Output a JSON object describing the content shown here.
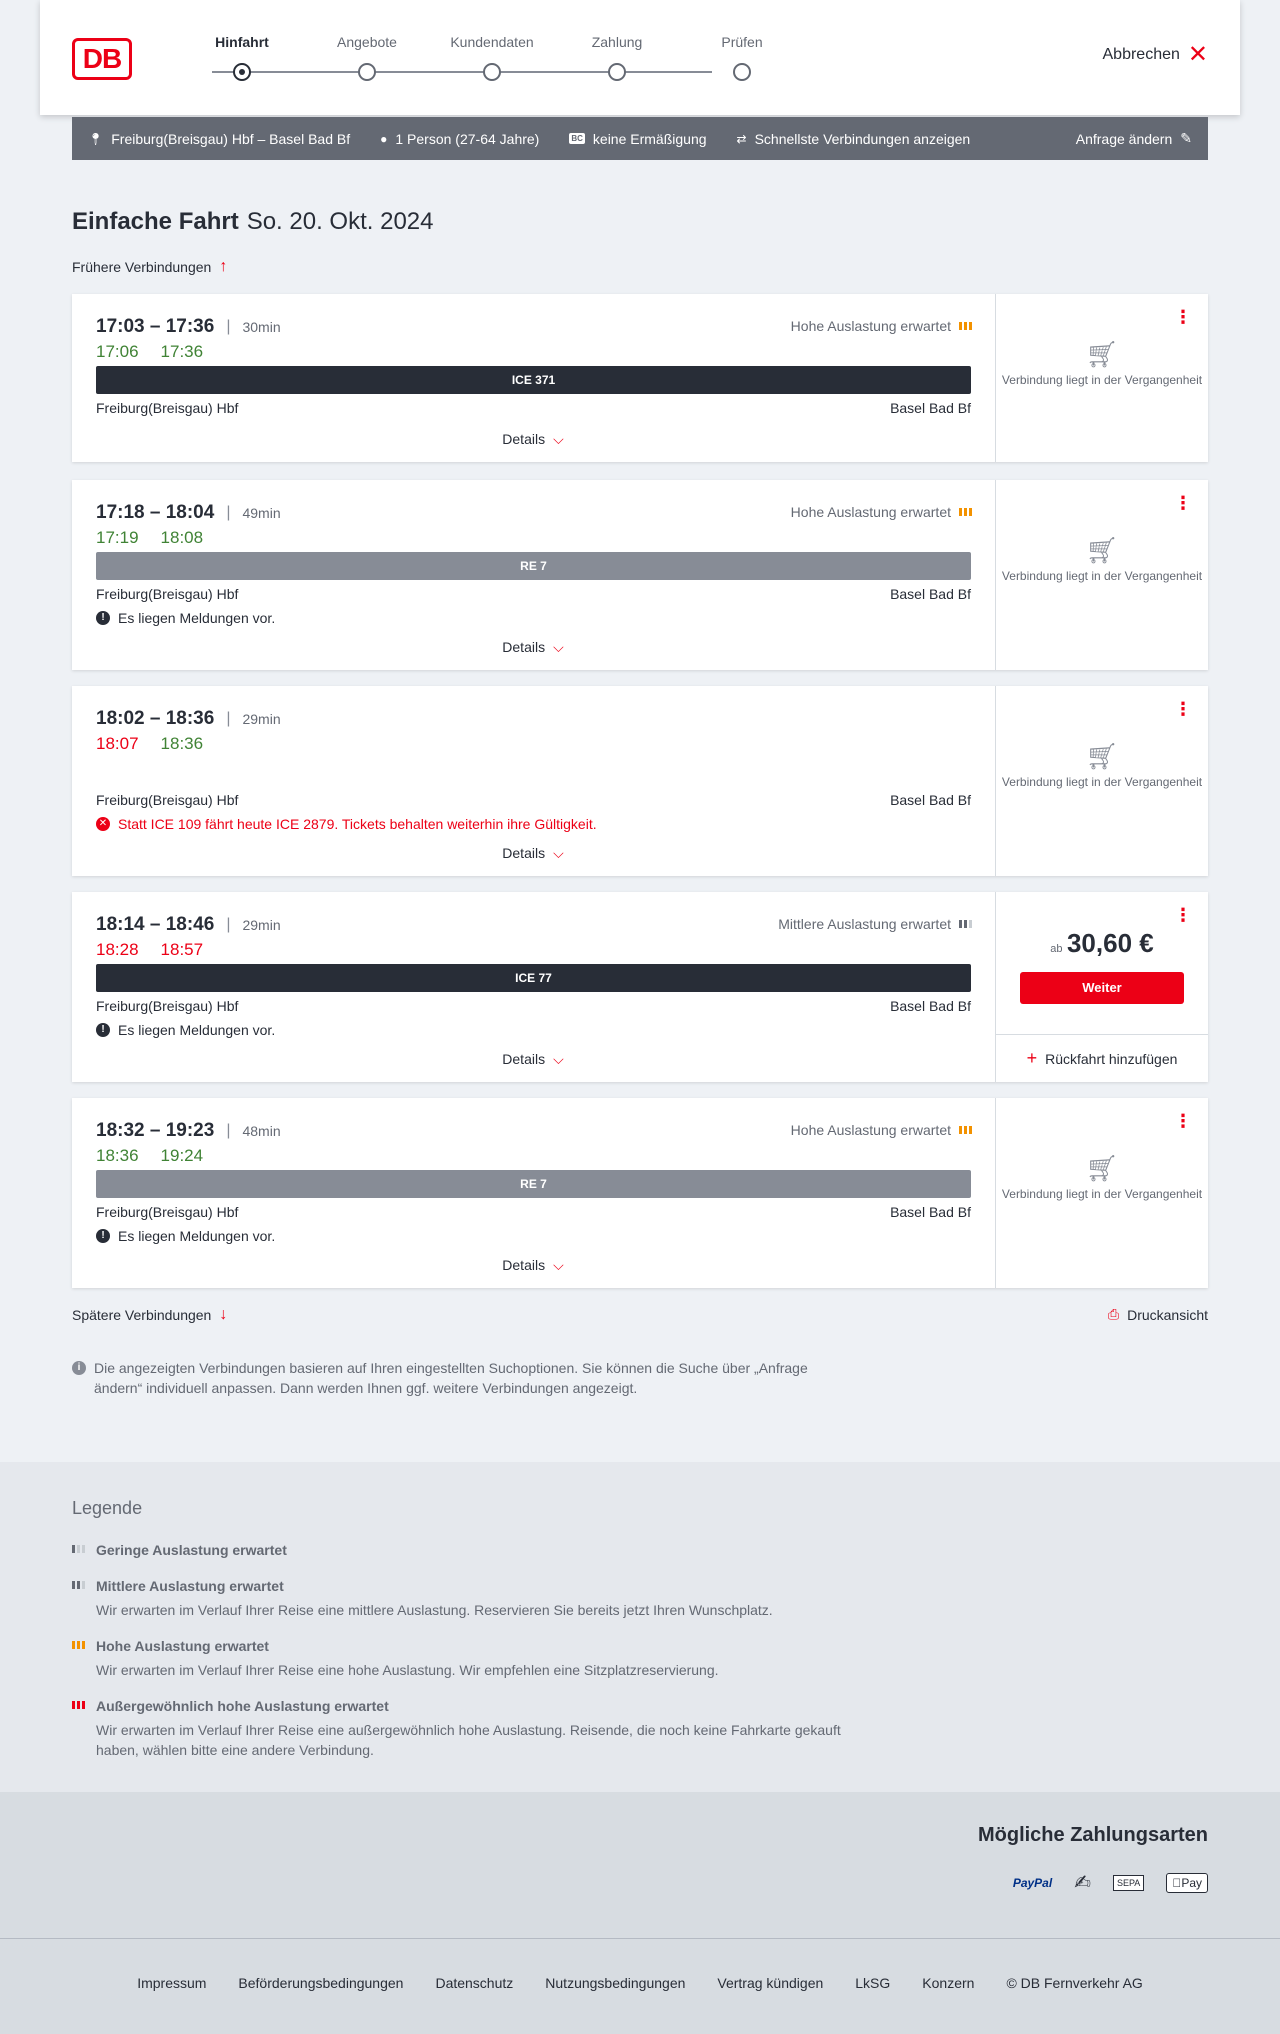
{
  "header": {
    "logo": "DB",
    "steps": [
      "Hinfahrt",
      "Angebote",
      "Kundendaten",
      "Zahlung",
      "Prüfen"
    ],
    "cancel": "Abbrechen"
  },
  "search": {
    "route": "Freiburg(Breisgau) Hbf – Basel Bad Bf",
    "passengers": "1 Person (27-64 Jahre)",
    "bc_badge": "BC",
    "discount": "keine Ermäßigung",
    "option": "Schnellste Verbindungen anzeigen",
    "change": "Anfrage ändern"
  },
  "title": {
    "type": "Einfache Fahrt",
    "date": "So. 20. Okt. 2024"
  },
  "earlier": "Frühere Verbindungen",
  "later": "Spätere Verbindungen",
  "print": "Druckansicht",
  "details_label": "Details",
  "past_text": "Verbindung liegt in der Vergangenheit",
  "connections": [
    {
      "time": "17:03 – 17:36",
      "dur": "30min",
      "rt_dep": "17:06",
      "rt_arr": "17:36",
      "load": "Hohe Auslastung erwartet",
      "train": "ICE 371",
      "from": "Freiburg(Breisgau) Hbf",
      "to": "Basel Bad Bf"
    },
    {
      "time": "17:18 – 18:04",
      "dur": "49min",
      "rt_dep": "17:19",
      "rt_arr": "18:08",
      "load": "Hohe Auslastung erwartet",
      "train": "RE 7",
      "from": "Freiburg(Breisgau) Hbf",
      "to": "Basel Bad Bf",
      "msg": "Es liegen Meldungen vor."
    },
    {
      "time": "18:02 – 18:36",
      "dur": "29min",
      "rt_dep": "18:07",
      "rt_arr": "18:36",
      "from": "Freiburg(Breisgau) Hbf",
      "to": "Basel Bad Bf",
      "msg": "Statt ICE 109 fährt heute ICE 2879. Tickets behalten weiterhin ihre Gültigkeit."
    },
    {
      "time": "18:14 – 18:46",
      "dur": "29min",
      "rt_dep": "18:28",
      "rt_arr": "18:57",
      "load": "Mittlere Auslastung erwartet",
      "train": "ICE 77",
      "from": "Freiburg(Breisgau) Hbf",
      "to": "Basel Bad Bf",
      "msg": "Es liegen Meldungen vor.",
      "price_prefix": "ab",
      "price": "30,60 €",
      "button": "Weiter",
      "add_return": "Rückfahrt hinzufügen"
    },
    {
      "time": "18:32 – 19:23",
      "dur": "48min",
      "rt_dep": "18:36",
      "rt_arr": "19:24",
      "load": "Hohe Auslastung erwartet",
      "train": "RE 7",
      "from": "Freiburg(Breisgau) Hbf",
      "to": "Basel Bad Bf",
      "msg": "Es liegen Meldungen vor."
    }
  ],
  "note": "Die angezeigten Verbindungen basieren auf Ihren eingestellten Suchoptionen. Sie können die Suche über „Anfrage ändern“ individuell anpassen. Dann werden Ihnen ggf. weitere Verbindungen angezeigt.",
  "legend": {
    "title": "Legende",
    "items": [
      {
        "title": "Geringe Auslastung erwartet",
        "desc": ""
      },
      {
        "title": "Mittlere Auslastung erwartet",
        "desc": "Wir erwarten im Verlauf Ihrer Reise eine mittlere Auslastung. Reservieren Sie bereits jetzt Ihren Wunschplatz."
      },
      {
        "title": "Hohe Auslastung erwartet",
        "desc": "Wir erwarten im Verlauf Ihrer Reise eine hohe Auslastung. Wir empfehlen eine Sitzplatzreservierung."
      },
      {
        "title": "Außergewöhnlich hohe Auslastung erwartet",
        "desc": "Wir erwarten im Verlauf Ihrer Reise eine außergewöhnlich hohe Auslastung. Reisende, die noch keine Fahrkarte gekauft haben, wählen bitte eine andere Verbindung."
      }
    ]
  },
  "payment": {
    "title": "Mögliche Zahlungsarten",
    "paypal": "PayPal",
    "sepa": "SEPA",
    "apple": "Pay"
  },
  "footer": [
    "Impressum",
    "Beförderungsbedingungen",
    "Datenschutz",
    "Nutzungsbedingungen",
    "Vertrag kündigen",
    "LkSG",
    "Konzern",
    "© DB Fernverkehr AG"
  ],
  "colors": {
    "brand": "#ec0016",
    "on_time": "#408335",
    "high_load": "#f39200",
    "dark": "#282d37"
  }
}
